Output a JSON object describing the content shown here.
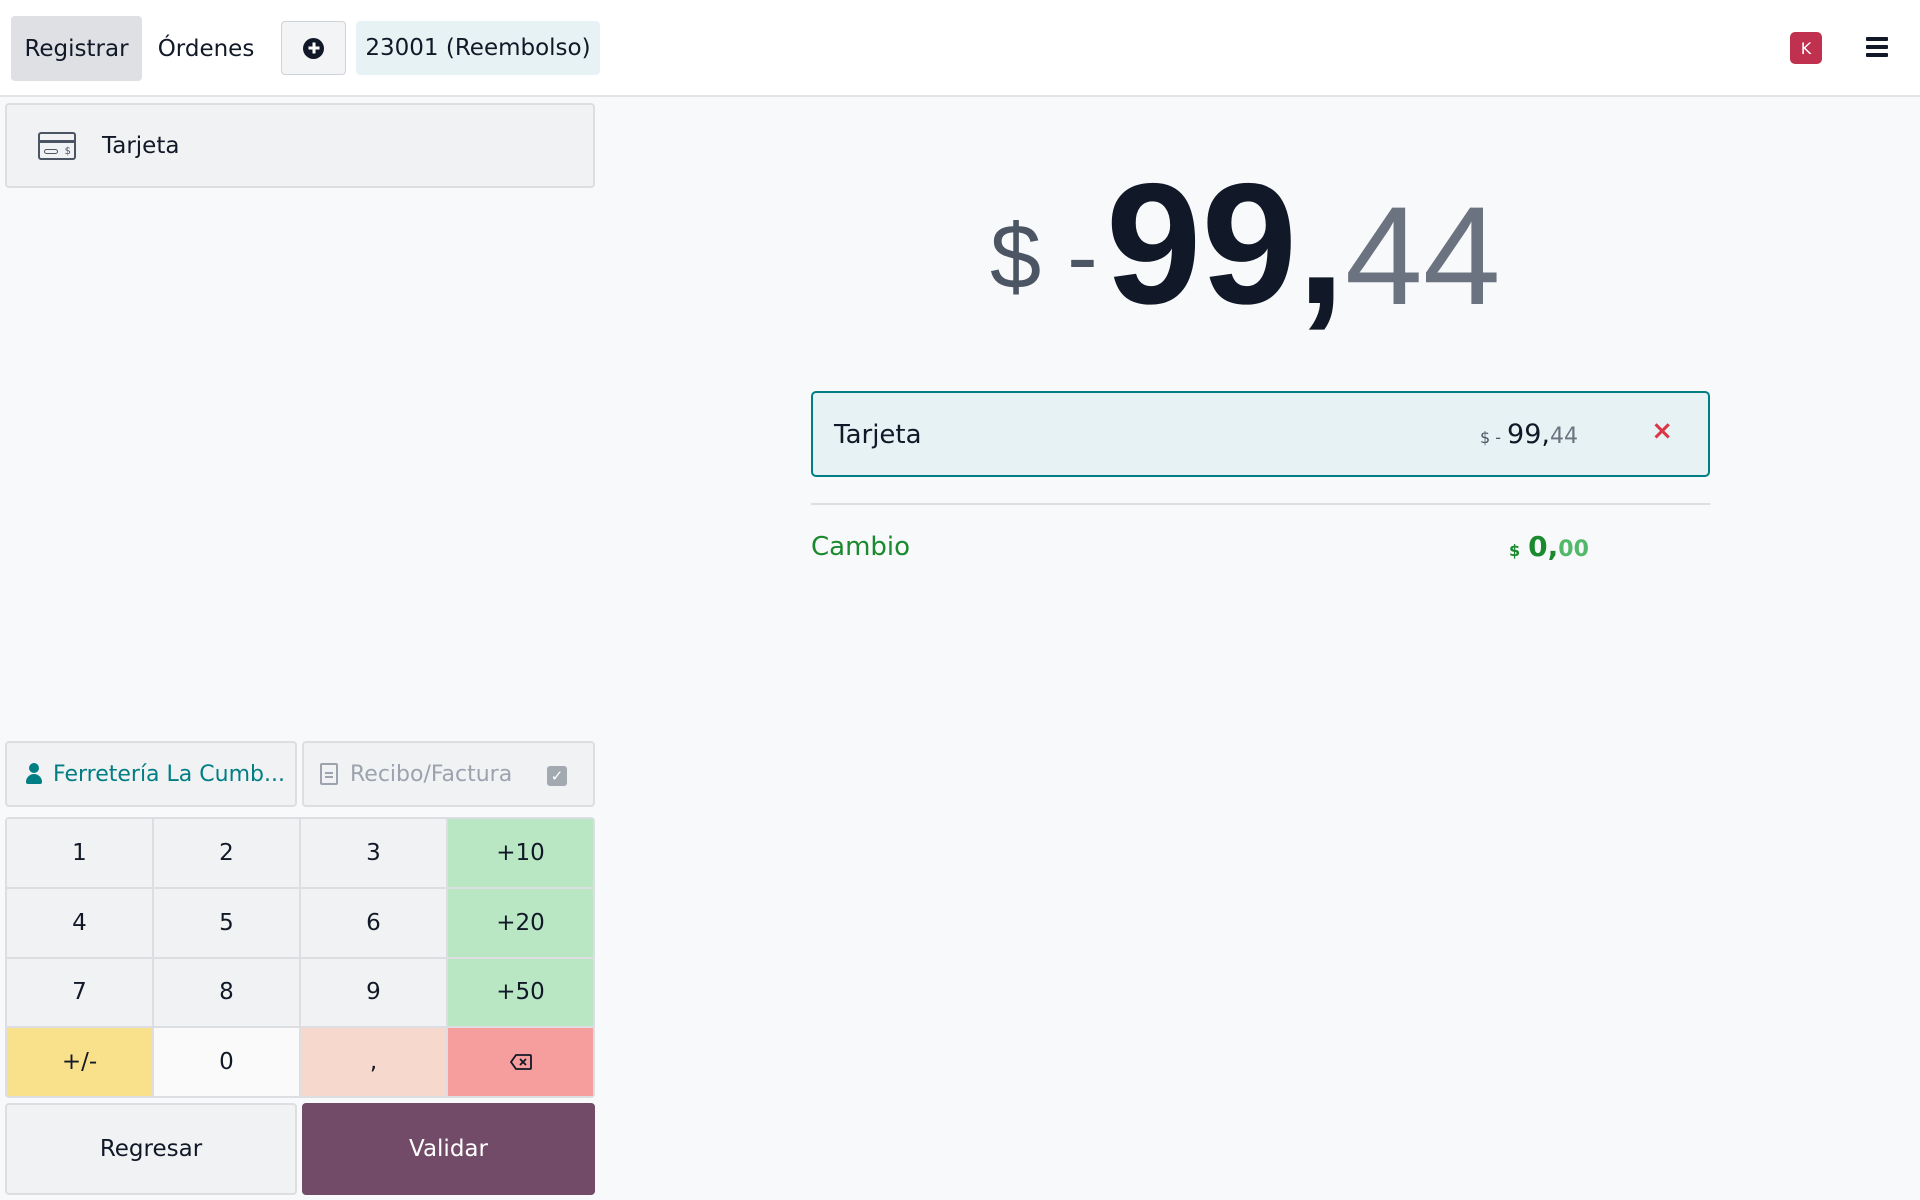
{
  "header": {
    "register_label": "Registrar",
    "orders_label": "Órdenes",
    "order_tab_label": "23001 (Reembolso)",
    "user_initial": "K"
  },
  "payment_methods": [
    {
      "label": "Tarjeta",
      "icon": "credit-card-icon"
    }
  ],
  "customer": {
    "label": "Ferretería La Cumb..."
  },
  "invoice": {
    "label": "Recibo/Factura",
    "checked": true
  },
  "numpad": {
    "keys": [
      "1",
      "2",
      "3",
      "+10",
      "4",
      "5",
      "6",
      "+20",
      "7",
      "8",
      "9",
      "+50",
      "+/-",
      "0",
      ","
    ]
  },
  "actions": {
    "back_label": "Regresar",
    "validate_label": "Validar"
  },
  "total": {
    "currency": "$",
    "sign": "-",
    "integer": "99,",
    "decimal": "44"
  },
  "payment_line": {
    "method": "Tarjeta",
    "currency_sign": "$ -",
    "integer": "99,",
    "decimal": "44",
    "delete_symbol": "×"
  },
  "change": {
    "label": "Cambio",
    "currency": "$",
    "integer": "0,",
    "decimal": "00"
  },
  "colors": {
    "accent": "#017e84",
    "validate": "#714b67",
    "change_green": "#1b8a2e",
    "delete_red": "#dc3545"
  }
}
